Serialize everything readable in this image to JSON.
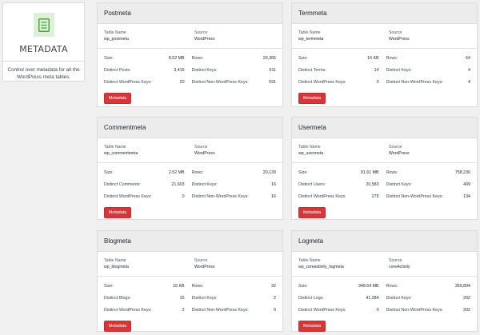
{
  "sidebar": {
    "icon": "document-list-icon",
    "title": "METADATA",
    "description": "Control over metadata for all the WordPress meta tables."
  },
  "labels": {
    "table_name": "Table Name",
    "source": "Source",
    "size": "Size:",
    "rows": "Rows:",
    "distinct_wp_keys": "Distinct WordPress Keys:",
    "distinct_keys": "Distinct Keys:",
    "distinct_non_wp_keys": "Distinct Non-WordPress Keys:",
    "button": "Metadata"
  },
  "cards": [
    {
      "title": "Postmeta",
      "table": "wp_postmeta",
      "source": "WordPress",
      "size": "8.52 MB",
      "rows": "29,366",
      "distinct_label": "Distinct Posts:",
      "distinct_value": "3,416",
      "distinct_keys": "611",
      "wp_keys": "20",
      "non_wp_keys": "591"
    },
    {
      "title": "Termmeta",
      "table": "wp_termmeta",
      "source": "WordPress",
      "size": "16 KB",
      "rows": "64",
      "distinct_label": "Distinct Terms:",
      "distinct_value": "14",
      "distinct_keys": "4",
      "wp_keys": "0",
      "non_wp_keys": "4"
    },
    {
      "title": "Commentmeta",
      "table": "wp_commentmeta",
      "source": "WordPress",
      "size": "2.52 MB",
      "rows": "20,139",
      "distinct_label": "Distinct Comments:",
      "distinct_value": "21,603",
      "distinct_keys": "16",
      "wp_keys": "0",
      "non_wp_keys": "16"
    },
    {
      "title": "Usermeta",
      "table": "wp_usermeta",
      "source": "WordPress",
      "size": "91.61 MB",
      "rows": "758,230",
      "distinct_label": "Distinct Users:",
      "distinct_value": "20,583",
      "distinct_keys": "409",
      "wp_keys": "275",
      "non_wp_keys": "134"
    },
    {
      "title": "Blogmeta",
      "table": "wp_blogmeta",
      "source": "WordPress",
      "size": "16 KB",
      "rows": "32",
      "distinct_label": "Distinct Blogs:",
      "distinct_value": "16",
      "distinct_keys": "2",
      "wp_keys": "2",
      "non_wp_keys": "0"
    },
    {
      "title": "Logmeta",
      "table": "wp_coreactivity_logmeta",
      "source": "coreActivity",
      "size": "948.64 MB",
      "rows": "359,894",
      "distinct_label": "Distinct Logs:",
      "distinct_value": "41,284",
      "distinct_keys": "202",
      "wp_keys": "0",
      "non_wp_keys": "202"
    }
  ]
}
